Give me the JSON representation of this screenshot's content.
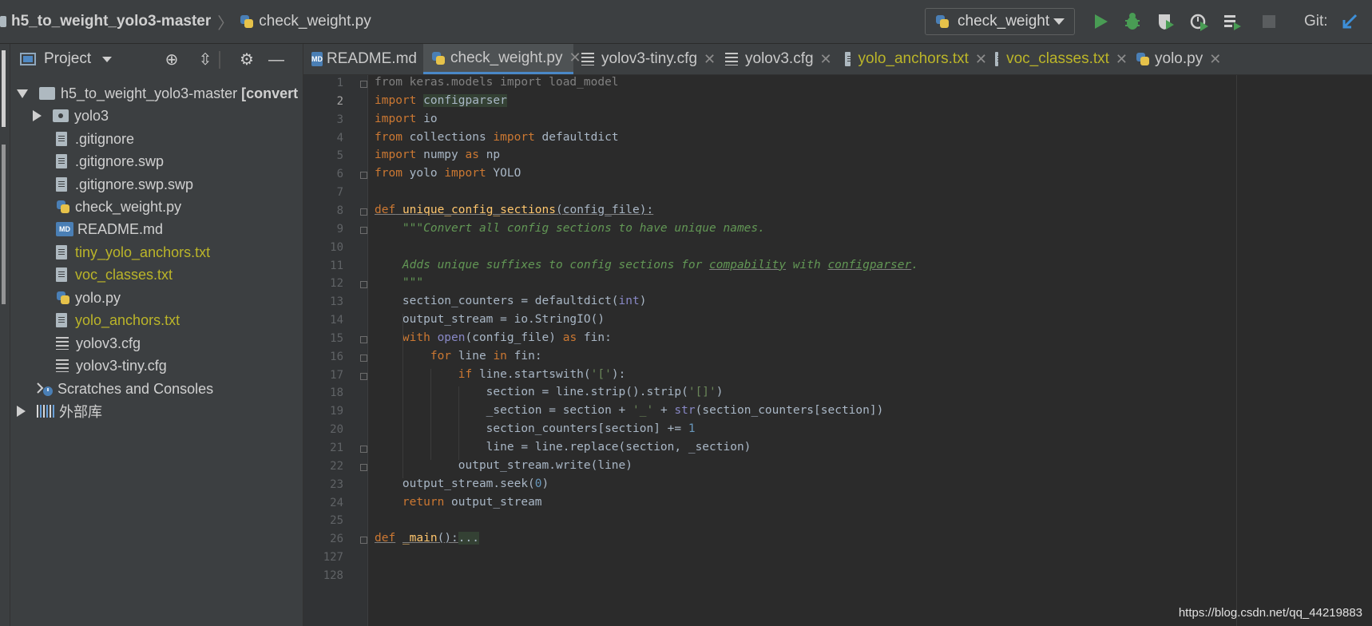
{
  "breadcrumbs": {
    "project": "h5_to_weight_yolo3-master",
    "file": "check_weight.py"
  },
  "toolbar": {
    "run_config": "check_weight",
    "git_label": "Git:",
    "icons": [
      "run-icon",
      "debug-icon",
      "coverage-icon",
      "profile-icon",
      "run-concurrency-icon",
      "stop-icon",
      "git-update-icon"
    ]
  },
  "project_panel": {
    "title": "Project",
    "tree": [
      {
        "label": "h5_to_weight_yolo3-master",
        "suffix": "[convert",
        "type": "folder"
      },
      {
        "label": "yolo3",
        "type": "folder"
      },
      {
        "label": ".gitignore",
        "type": "file"
      },
      {
        "label": ".gitignore.swp",
        "type": "file"
      },
      {
        "label": ".gitignore.swp.swp",
        "type": "file"
      },
      {
        "label": "check_weight.py",
        "type": "python"
      },
      {
        "label": "README.md",
        "type": "markdown"
      },
      {
        "label": "tiny_yolo_anchors.txt",
        "type": "text"
      },
      {
        "label": "voc_classes.txt",
        "type": "text"
      },
      {
        "label": "yolo.py",
        "type": "python"
      },
      {
        "label": "yolo_anchors.txt",
        "type": "text"
      },
      {
        "label": "yolov3.cfg",
        "type": "cfg"
      },
      {
        "label": "yolov3-tiny.cfg",
        "type": "cfg"
      },
      {
        "label": "Scratches and Consoles",
        "type": "scratch"
      },
      {
        "label": "外部库",
        "type": "library"
      }
    ]
  },
  "tabs": [
    {
      "label": "README.md",
      "active": false
    },
    {
      "label": "check_weight.py",
      "active": true
    },
    {
      "label": "yolov3-tiny.cfg",
      "active": false
    },
    {
      "label": "yolov3.cfg",
      "active": false
    },
    {
      "label": "yolo_anchors.txt",
      "active": false
    },
    {
      "label": "voc_classes.txt",
      "active": false
    },
    {
      "label": "yolo.py",
      "active": false
    }
  ],
  "editor": {
    "current_line": 2,
    "line_numbers": [
      "1",
      "2",
      "3",
      "4",
      "5",
      "6",
      "7",
      "8",
      "9",
      "10",
      "11",
      "12",
      "13",
      "14",
      "15",
      "16",
      "17",
      "18",
      "19",
      "20",
      "21",
      "22",
      "23",
      "24",
      "25",
      "26",
      "127",
      "128"
    ],
    "lines": [
      "from keras.models import load_model",
      "import configparser",
      "import io",
      "from collections import defaultdict",
      "import numpy as np",
      "from yolo import YOLO",
      "",
      "def unique_config_sections(config_file):",
      "    \"\"\"Convert all config sections to have unique names.",
      "",
      "    Adds unique suffixes to config sections for compability with configparser.",
      "    \"\"\"",
      "    section_counters = defaultdict(int)",
      "    output_stream = io.StringIO()",
      "    with open(config_file) as fin:",
      "        for line in fin:",
      "            if line.startswith('['):",
      "                section = line.strip().strip('[]')",
      "                _section = section + '_' + str(section_counters[section])",
      "                section_counters[section] += 1",
      "                line = line.replace(section, _section)",
      "            output_stream.write(line)",
      "    output_stream.seek(0)",
      "    return output_stream",
      "",
      "def _main():...",
      "",
      ""
    ]
  },
  "watermark": "https://blog.csdn.net/qq_44219883"
}
